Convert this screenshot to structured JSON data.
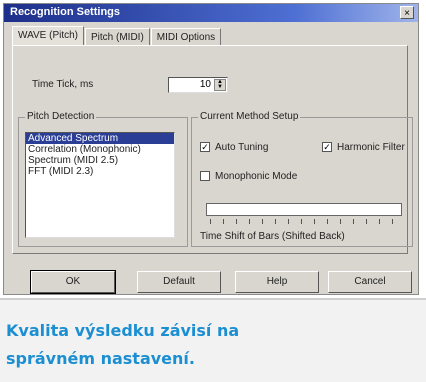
{
  "window": {
    "title": "Recognition Settings",
    "close_glyph": "×"
  },
  "tabs": [
    {
      "label": "WAVE (Pitch)",
      "active": true
    },
    {
      "label": "Pitch (MIDI)",
      "active": false
    },
    {
      "label": "MIDI Options",
      "active": false
    }
  ],
  "time_tick": {
    "label": "Time Tick, ms",
    "value": "10"
  },
  "pitch_detection": {
    "title": "Pitch Detection",
    "items": [
      {
        "label": "Advanced Spectrum",
        "selected": true
      },
      {
        "label": "Correlation (Monophonic)",
        "selected": false
      },
      {
        "label": "Spectrum (MIDI 2.5)",
        "selected": false
      },
      {
        "label": "FFT (MIDI 2.3)",
        "selected": false
      }
    ]
  },
  "method_setup": {
    "title": "Current Method Setup",
    "auto_tuning": {
      "label": "Auto Tuning",
      "checked": true
    },
    "harmonic_filter": {
      "label": "Harmonic Filter",
      "checked": true
    },
    "monophonic_mode": {
      "label": "Monophonic Mode",
      "checked": false
    },
    "slider_label": "Time Shift of Bars (Shifted Back)"
  },
  "buttons": {
    "ok": "OK",
    "default": "Default",
    "help": "Help",
    "cancel": "Cancel"
  },
  "caption": "Kvalita výsledku závisí na správném nastavení.",
  "colors": {
    "titlebar": "#1c2f8a",
    "dialog_bg": "#d9d6cf",
    "selection": "#2a3e96",
    "caption_text": "#1b8fd2"
  }
}
